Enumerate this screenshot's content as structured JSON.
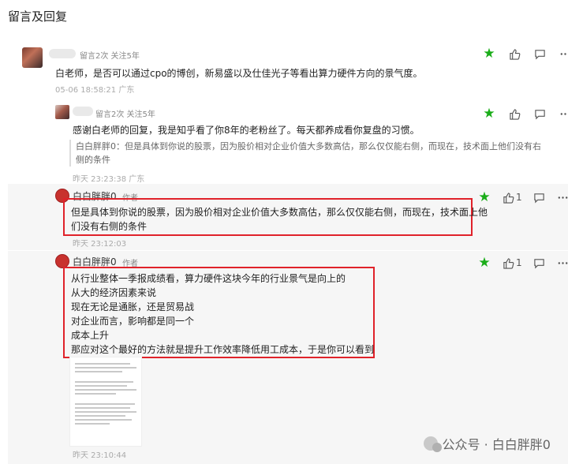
{
  "page": {
    "title": "留言及回复"
  },
  "c1": {
    "meta": "留言2次 关注5年",
    "text": "白老师，是否可以通过cpo的博创，新易盛以及仕佳光子等看出算力硬件方向的景气度。",
    "time": "05-06 18:58:21 广东"
  },
  "c2": {
    "meta": "留言2次 关注5年",
    "text": "感谢白老师的回复，我是知乎看了你8年的老粉丝了。每天都养成看你复盘的习惯。",
    "quote_line1": "白白胖胖0：但是具体到你说的股票，因为股价相对企业价值大多数高估，那么仅仅能右侧，而现在，技术面上他们没有右",
    "quote_line2": "侧的条件",
    "time": "昨天 23:23:38 广东"
  },
  "r1": {
    "name": "白白胖胖0",
    "tag": "作者",
    "line1": "但是具体到你说的股票，因为股价相对企业价值大多数高估，那么仅仅能右侧，而现在，技术面上他",
    "line2": "们没有右侧的条件",
    "like_count": "1",
    "time": "昨天 23:12:03"
  },
  "r2": {
    "name": "白白胖胖0",
    "tag": "作者",
    "lines": [
      "从行业整体一季报成绩看，算力硬件这块今年的行业景气是向上的",
      "从大的经济因素来说",
      "现在无论是通胀，还是贸易战",
      "对企业而言，影响都是同一个",
      "成本上升",
      "那应对这个最好的方法就是提升工作效率降低用工成本，于是你可以看到"
    ],
    "like_count": "1",
    "time": "昨天 23:10:44"
  },
  "watermark": {
    "text": "公众号 · 白白胖胖0"
  },
  "icons": [
    "star-icon",
    "thumb-up-icon",
    "comment-icon",
    "more-icon"
  ],
  "colors": {
    "accent_green": "#1aad19",
    "highlight_red": "#e0222a"
  }
}
